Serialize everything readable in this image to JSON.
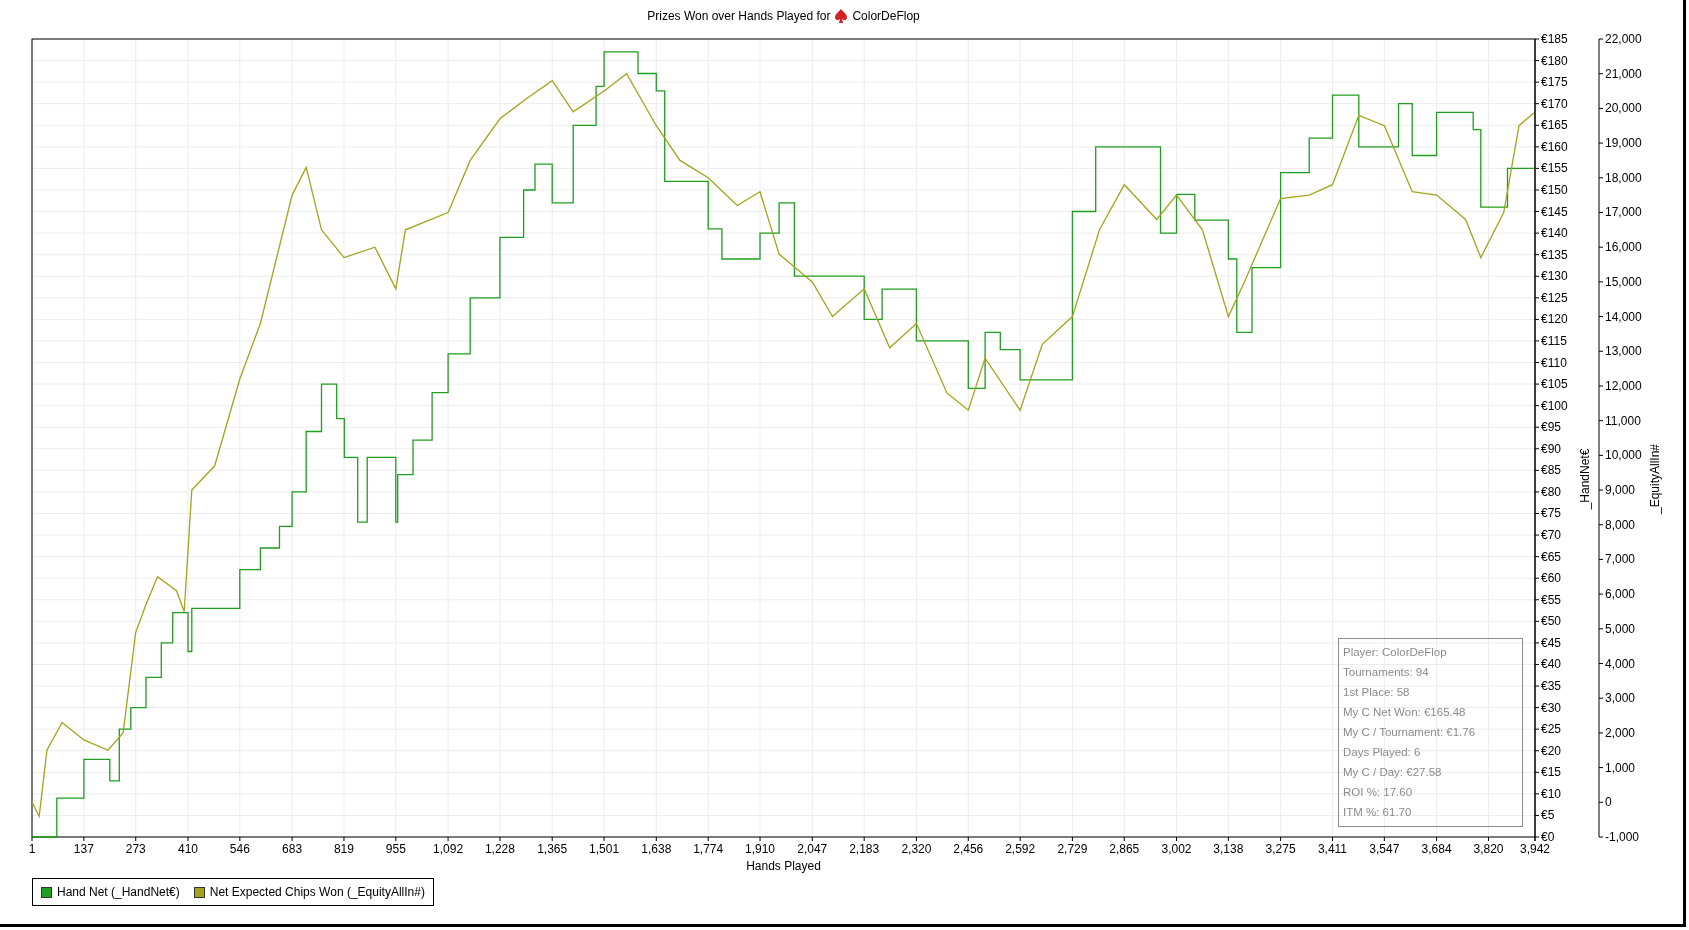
{
  "header": {
    "title": "Prizes Won over Hands Played for",
    "player": "ColorDeFlop"
  },
  "chart_data": {
    "type": "line",
    "grid": true,
    "xlabel": "Hands Played",
    "ylabel": "_HandNet€",
    "y2label": "_EquityAllIn#",
    "xlim": [
      1,
      3942
    ],
    "ylim": [
      0,
      185
    ],
    "y2lim": [
      -1000,
      22000
    ],
    "xticks": [
      {
        "value": 1,
        "label": "1"
      },
      {
        "value": 137,
        "label": "137"
      },
      {
        "value": 273,
        "label": "273"
      },
      {
        "value": 410,
        "label": "410"
      },
      {
        "value": 546,
        "label": "546"
      },
      {
        "value": 683,
        "label": "683"
      },
      {
        "value": 819,
        "label": "819"
      },
      {
        "value": 955,
        "label": "955"
      },
      {
        "value": 1092,
        "label": "1,092"
      },
      {
        "value": 1228,
        "label": "1,228"
      },
      {
        "value": 1365,
        "label": "1,365"
      },
      {
        "value": 1501,
        "label": "1,501"
      },
      {
        "value": 1638,
        "label": "1,638"
      },
      {
        "value": 1774,
        "label": "1,774"
      },
      {
        "value": 1910,
        "label": "1,910"
      },
      {
        "value": 2047,
        "label": "2,047"
      },
      {
        "value": 2183,
        "label": "2,183"
      },
      {
        "value": 2320,
        "label": "2,320"
      },
      {
        "value": 2456,
        "label": "2,456"
      },
      {
        "value": 2592,
        "label": "2,592"
      },
      {
        "value": 2729,
        "label": "2,729"
      },
      {
        "value": 2865,
        "label": "2,865"
      },
      {
        "value": 3002,
        "label": "3,002"
      },
      {
        "value": 3138,
        "label": "3,138"
      },
      {
        "value": 3275,
        "label": "3,275"
      },
      {
        "value": 3411,
        "label": "3,411"
      },
      {
        "value": 3547,
        "label": "3,547"
      },
      {
        "value": 3684,
        "label": "3,684"
      },
      {
        "value": 3820,
        "label": "3,820"
      },
      {
        "value": 3942,
        "label": "3,942"
      }
    ],
    "yticks": [
      {
        "value": 0,
        "label": "€0"
      },
      {
        "value": 5,
        "label": "€5"
      },
      {
        "value": 10,
        "label": "€10"
      },
      {
        "value": 15,
        "label": "€15"
      },
      {
        "value": 20,
        "label": "€20"
      },
      {
        "value": 25,
        "label": "€25"
      },
      {
        "value": 30,
        "label": "€30"
      },
      {
        "value": 35,
        "label": "€35"
      },
      {
        "value": 40,
        "label": "€40"
      },
      {
        "value": 45,
        "label": "€45"
      },
      {
        "value": 50,
        "label": "€50"
      },
      {
        "value": 55,
        "label": "€55"
      },
      {
        "value": 60,
        "label": "€60"
      },
      {
        "value": 65,
        "label": "€65"
      },
      {
        "value": 70,
        "label": "€70"
      },
      {
        "value": 75,
        "label": "€75"
      },
      {
        "value": 80,
        "label": "€80"
      },
      {
        "value": 85,
        "label": "€85"
      },
      {
        "value": 90,
        "label": "€90"
      },
      {
        "value": 95,
        "label": "€95"
      },
      {
        "value": 100,
        "label": "€100"
      },
      {
        "value": 105,
        "label": "€105"
      },
      {
        "value": 110,
        "label": "€110"
      },
      {
        "value": 115,
        "label": "€115"
      },
      {
        "value": 120,
        "label": "€120"
      },
      {
        "value": 125,
        "label": "€125"
      },
      {
        "value": 130,
        "label": "€130"
      },
      {
        "value": 135,
        "label": "€135"
      },
      {
        "value": 140,
        "label": "€140"
      },
      {
        "value": 145,
        "label": "€145"
      },
      {
        "value": 150,
        "label": "€150"
      },
      {
        "value": 155,
        "label": "€155"
      },
      {
        "value": 160,
        "label": "€160"
      },
      {
        "value": 165,
        "label": "€165"
      },
      {
        "value": 170,
        "label": "€170"
      },
      {
        "value": 175,
        "label": "€175"
      },
      {
        "value": 180,
        "label": "€180"
      },
      {
        "value": 185,
        "label": "€185"
      }
    ],
    "y2ticks": [
      {
        "value": -1000,
        "label": "-1,000"
      },
      {
        "value": 0,
        "label": "0"
      },
      {
        "value": 1000,
        "label": "1,000"
      },
      {
        "value": 2000,
        "label": "2,000"
      },
      {
        "value": 3000,
        "label": "3,000"
      },
      {
        "value": 4000,
        "label": "4,000"
      },
      {
        "value": 5000,
        "label": "5,000"
      },
      {
        "value": 6000,
        "label": "6,000"
      },
      {
        "value": 7000,
        "label": "7,000"
      },
      {
        "value": 8000,
        "label": "8,000"
      },
      {
        "value": 9000,
        "label": "9,000"
      },
      {
        "value": 10000,
        "label": "10,000"
      },
      {
        "value": 11000,
        "label": "11,000"
      },
      {
        "value": 12000,
        "label": "12,000"
      },
      {
        "value": 13000,
        "label": "13,000"
      },
      {
        "value": 14000,
        "label": "14,000"
      },
      {
        "value": 15000,
        "label": "15,000"
      },
      {
        "value": 16000,
        "label": "16,000"
      },
      {
        "value": 17000,
        "label": "17,000"
      },
      {
        "value": 18000,
        "label": "18,000"
      },
      {
        "value": 19000,
        "label": "19,000"
      },
      {
        "value": 20000,
        "label": "20,000"
      },
      {
        "value": 21000,
        "label": "21,000"
      },
      {
        "value": 22000,
        "label": "22,000"
      }
    ],
    "series": [
      {
        "name": "Hand Net (_HandNet€)",
        "color": "#1f9e1f",
        "x": [
          1,
          66,
          66,
          137,
          137,
          205,
          205,
          230,
          230,
          260,
          260,
          300,
          300,
          340,
          340,
          370,
          370,
          410,
          410,
          420,
          420,
          546,
          546,
          600,
          600,
          650,
          650,
          683,
          683,
          720,
          720,
          760,
          760,
          800,
          800,
          820,
          820,
          855,
          855,
          880,
          880,
          955,
          955,
          960,
          960,
          1000,
          1000,
          1050,
          1050,
          1092,
          1092,
          1150,
          1150,
          1228,
          1228,
          1290,
          1290,
          1320,
          1320,
          1365,
          1365,
          1420,
          1420,
          1480,
          1480,
          1501,
          1501,
          1590,
          1590,
          1638,
          1638,
          1660,
          1660,
          1774,
          1774,
          1810,
          1810,
          1910,
          1910,
          1960,
          1960,
          2000,
          2000,
          2183,
          2183,
          2230,
          2230,
          2320,
          2320,
          2456,
          2456,
          2500,
          2500,
          2540,
          2540,
          2592,
          2592,
          2729,
          2729,
          2790,
          2790,
          2960,
          2960,
          3002,
          3002,
          3050,
          3050,
          3138,
          3138,
          3160,
          3160,
          3200,
          3200,
          3275,
          3275,
          3350,
          3350,
          3411,
          3411,
          3480,
          3480,
          3584,
          3584,
          3620,
          3620,
          3684,
          3684,
          3780,
          3780,
          3800,
          3800,
          3870,
          3870,
          3942
        ],
        "values": [
          0,
          0,
          9,
          9,
          18,
          18,
          13,
          13,
          25,
          25,
          30,
          30,
          37,
          37,
          45,
          45,
          52,
          52,
          43,
          43,
          53,
          53,
          62,
          62,
          67,
          67,
          72,
          72,
          80,
          80,
          94,
          94,
          105,
          105,
          97,
          97,
          88,
          88,
          73,
          73,
          88,
          88,
          73,
          73,
          84,
          84,
          92,
          92,
          103,
          103,
          112,
          112,
          125,
          125,
          139,
          139,
          150,
          150,
          156,
          156,
          147,
          147,
          165,
          165,
          174,
          174,
          182,
          182,
          177,
          177,
          173,
          173,
          152,
          152,
          141,
          141,
          134,
          134,
          140,
          140,
          147,
          147,
          130,
          130,
          120,
          120,
          127,
          127,
          115,
          115,
          104,
          104,
          117,
          117,
          113,
          113,
          106,
          106,
          145,
          145,
          160,
          160,
          140,
          140,
          149,
          149,
          143,
          143,
          134,
          134,
          117,
          117,
          132,
          132,
          154,
          154,
          162,
          162,
          172,
          172,
          160,
          160,
          170,
          170,
          158,
          158,
          168,
          168,
          164,
          164,
          146,
          146,
          155,
          155
        ]
      },
      {
        "name": "Net Expected Chips Won (_EquityAllIn#)",
        "color": "#a3a31c",
        "axis": "y2",
        "x": [
          1,
          20,
          40,
          80,
          137,
          200,
          240,
          273,
          300,
          330,
          380,
          400,
          420,
          480,
          546,
          600,
          683,
          720,
          760,
          819,
          900,
          955,
          980,
          1092,
          1150,
          1228,
          1300,
          1365,
          1420,
          1501,
          1560,
          1638,
          1700,
          1774,
          1850,
          1910,
          1960,
          2047,
          2100,
          2183,
          2250,
          2320,
          2400,
          2456,
          2500,
          2592,
          2650,
          2729,
          2800,
          2865,
          2950,
          3002,
          3070,
          3138,
          3180,
          3275,
          3350,
          3411,
          3480,
          3547,
          3620,
          3684,
          3760,
          3800,
          3860,
          3900,
          3942
        ],
        "values": [
          0,
          -400,
          1500,
          2300,
          1800,
          1500,
          2000,
          4900,
          5700,
          6500,
          6100,
          5500,
          9000,
          9700,
          12200,
          13800,
          17500,
          18300,
          16500,
          15700,
          16000,
          14800,
          16500,
          17000,
          18500,
          19700,
          20300,
          20800,
          19900,
          20500,
          21000,
          19500,
          18500,
          18000,
          17200,
          17600,
          15800,
          15000,
          14000,
          14800,
          13100,
          13800,
          11800,
          11300,
          12800,
          11300,
          13200,
          14000,
          16500,
          17800,
          16800,
          17500,
          16500,
          14000,
          15000,
          17400,
          17500,
          17800,
          19800,
          19500,
          17600,
          17500,
          16800,
          15700,
          17000,
          19500,
          19900
        ]
      }
    ]
  },
  "stats": [
    "Player: ColorDeFlop",
    "Tournaments: 94",
    "1st Place: 58",
    "My C Net Won: €165.48",
    "My C / Tournament: €1.76",
    "Days Played: 6",
    "My C / Day: €27.58",
    "ROI %: 17.60",
    "ITM %: 61.70"
  ]
}
